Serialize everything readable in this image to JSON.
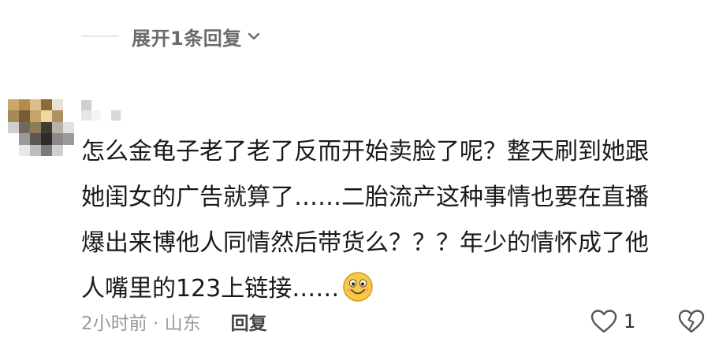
{
  "replies": {
    "expand_label": "展开1条回复"
  },
  "comment": {
    "lines": [
      "怎么金龟子老了老了反而开始卖脸了呢？整天刷到她跟",
      "她闺女的广告就算了……二胎流产这种事情也要在直播",
      "爆出来博他人同情然后带货么？？？年少的情怀成了他",
      "人嘴里的123上链接……"
    ],
    "emoji": "smile-emoji",
    "time_location": "2小时前 · 山东",
    "reply_label": "回复",
    "like_count": "1"
  },
  "colors": {
    "text": "#1a1a1a",
    "secondary": "#9a9a9a",
    "icon": "#555555",
    "emoji_face": "#f7c948"
  }
}
